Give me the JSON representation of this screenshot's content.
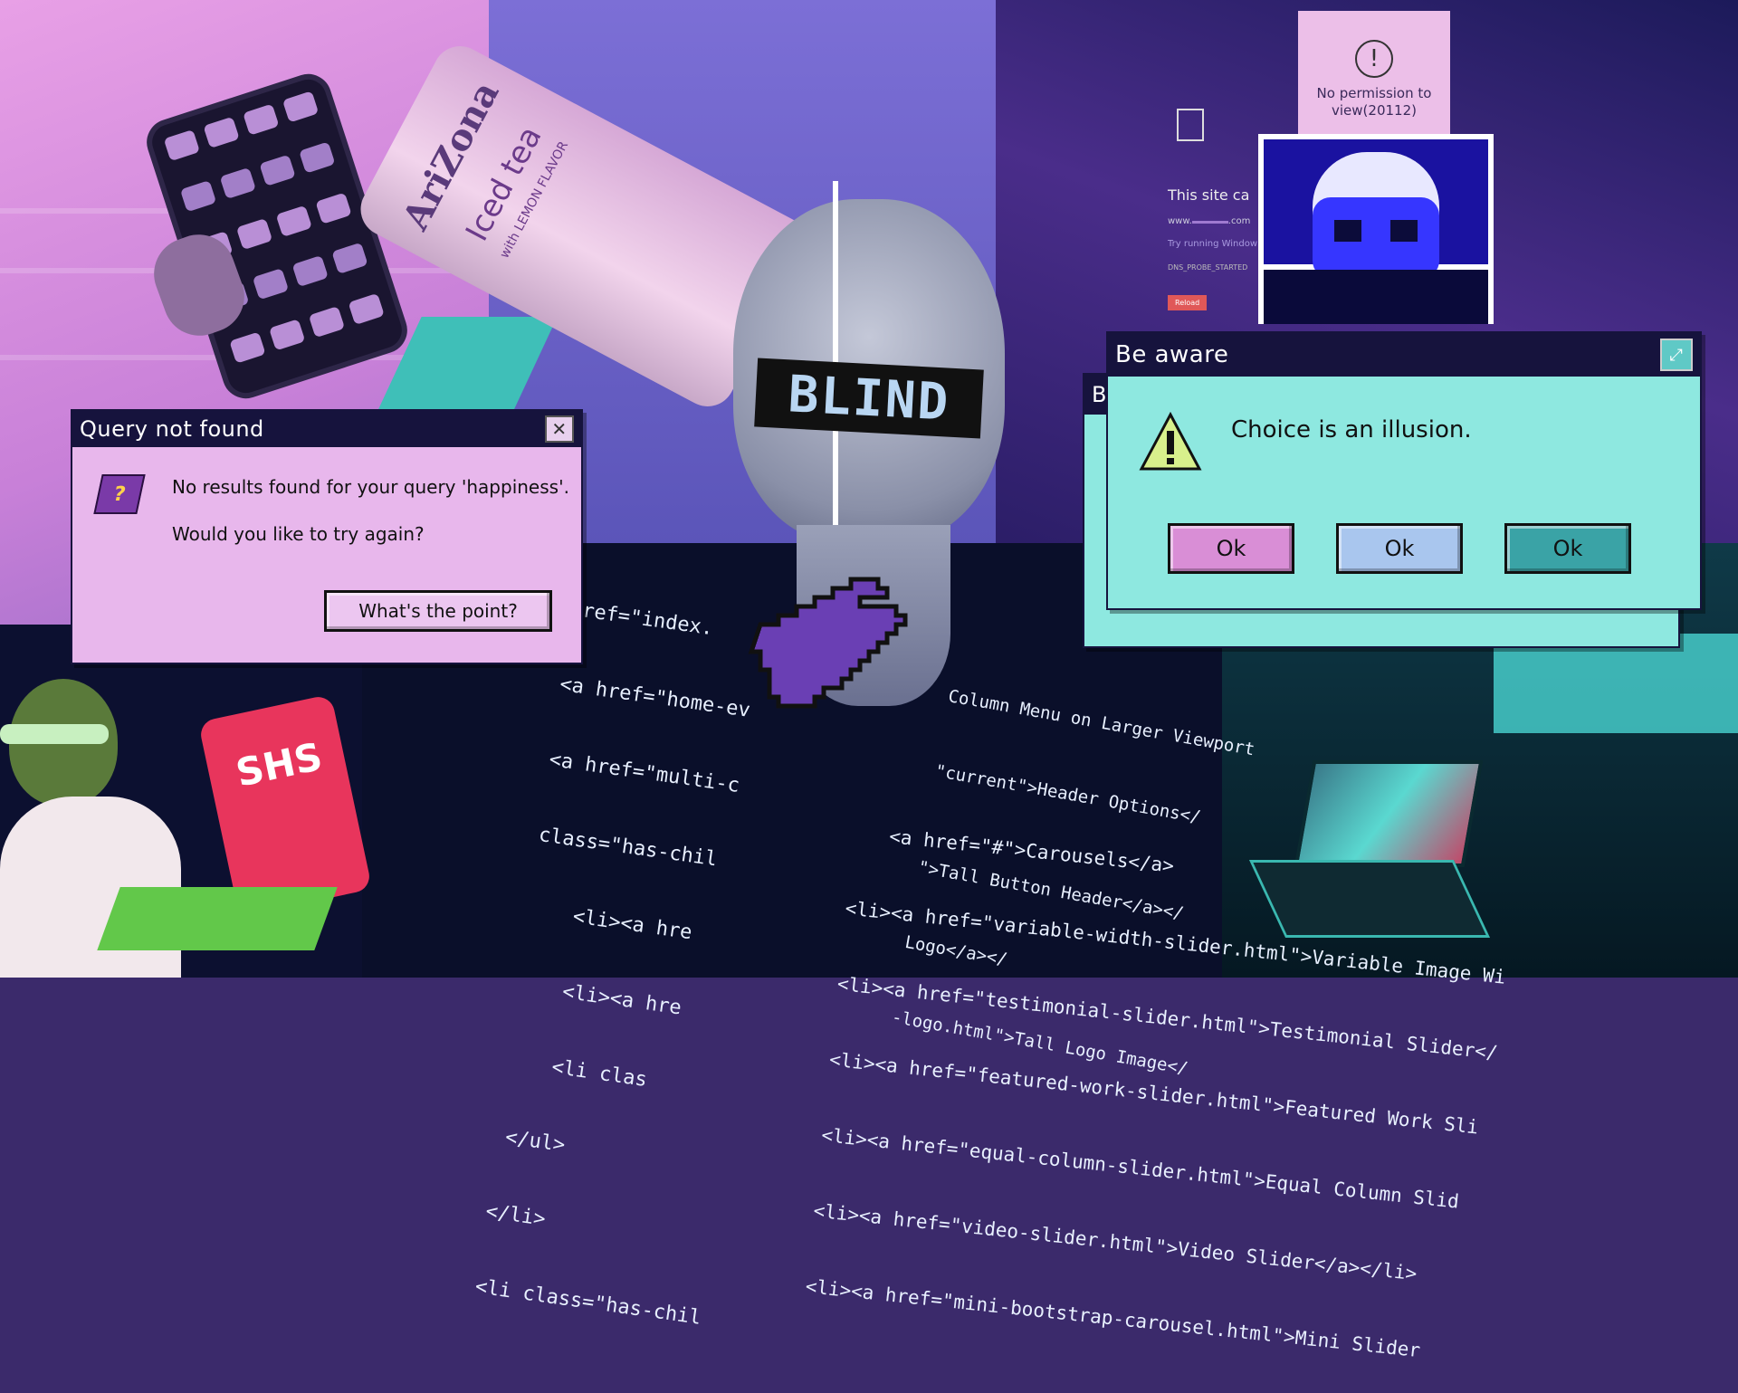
{
  "query_dialog": {
    "title": "Query not found",
    "message_1": "No results found for your query 'happiness'.",
    "message_2": "Would you like to try again?",
    "button": "What's the point?"
  },
  "aware_dialog": {
    "title": "Be aware",
    "message": "Choice is an illusion.",
    "buttons": [
      "Ok",
      "Ok",
      "Ok"
    ],
    "button_colors": [
      "#d98ed6",
      "#a9c6ee",
      "#3aa3a6"
    ],
    "behind_title": "B"
  },
  "permission_popup": {
    "text": "No permission to view(20112)"
  },
  "browser_error": {
    "heading": "This site ca",
    "url": "www.",
    "url_suffix": ".com",
    "hint": "Try running Window",
    "code": "DNS_PROBE_STARTED",
    "reload": "Reload"
  },
  "statue_label": "BLIND",
  "laptop_badge": "SHS",
  "code_lines": [
    "href=\"index.",
    "<a href=\"home-ev",
    "<a href=\"multi-c",
    "class=\"has-chil",
    "<li><a hre",
    "<li><a hre",
    "<li clas",
    "</ul>",
    "</li>",
    "<li class=\"has-chil",
    "<a href=\"#\">Carousels</a>",
    "<li><a href=\"variable-width-slider.html\">Variable Image Wi",
    "<li><a href=\"testimonial-slider.html\">Testimonial Slider</",
    "<li><a href=\"featured-work-slider.html\">Featured Work Sli",
    "<li><a href=\"equal-column-slider.html\">Equal Column Slid",
    "<li><a href=\"video-slider.html\">Video Slider</a></li>",
    "<li><a href=\"mini-bootstrap-carousel.html\">Mini Slider"
  ],
  "code_right": [
    "Column Menu on Larger Viewport",
    "\"current\">Header Options</",
    "\">Tall Button Header</a></",
    "Logo</a></",
    "-logo.html\">Tall Logo Image</"
  ],
  "can_text": {
    "brand": "AriZona",
    "flavor": "Iced tea",
    "sub": "with LEMON FLAVOR"
  },
  "colors": {
    "titlebar": "#16133d",
    "query_body": "#e8b7ec",
    "aware_body": "#8ee8e0"
  }
}
